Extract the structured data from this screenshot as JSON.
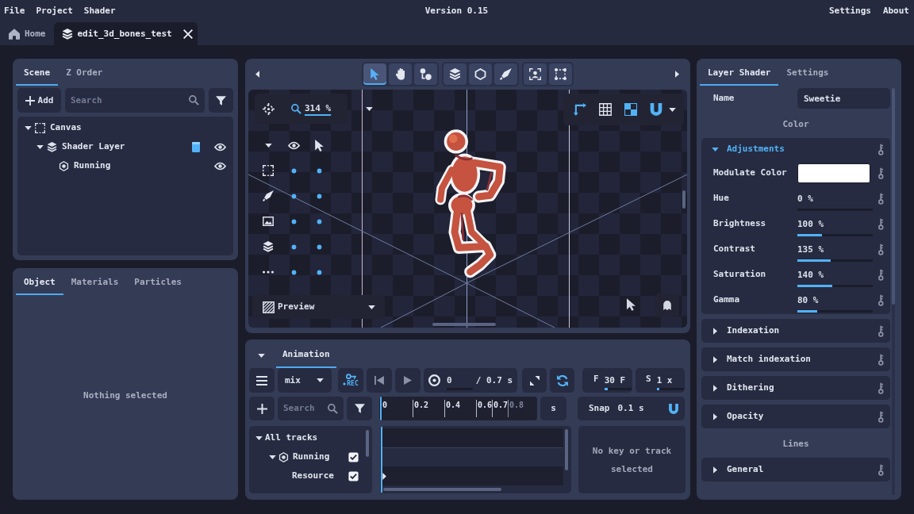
{
  "menu": {
    "items": [
      "File",
      "Project",
      "Shader"
    ],
    "version": "Version 0.15",
    "right_items": [
      "Settings",
      "About"
    ]
  },
  "tabs": [
    {
      "label": "Home",
      "kind": "home",
      "selected": false,
      "closable": false
    },
    {
      "label": "edit_3d_bones_test",
      "kind": "project",
      "selected": true,
      "closable": true
    }
  ],
  "scene_panel": {
    "tabs": [
      {
        "label": "Scene",
        "selected": true
      },
      {
        "label": "Z Order",
        "selected": false
      }
    ],
    "add_button": "Add",
    "search": {
      "placeholder": "Search"
    },
    "tree": [
      {
        "label": "Canvas",
        "kind": "canvas",
        "expanded": true,
        "children": [
          {
            "label": "Shader Layer",
            "kind": "layer",
            "expanded": true,
            "script": true,
            "visible": true,
            "children": [
              {
                "label": "Running",
                "kind": "object",
                "visible": true
              }
            ]
          }
        ]
      }
    ]
  },
  "object_panel": {
    "tabs": [
      {
        "label": "Object",
        "selected": true
      },
      {
        "label": "Materials",
        "selected": false
      },
      {
        "label": "Particles",
        "selected": false
      }
    ],
    "message": "Nothing selected"
  },
  "viewport": {
    "tool_groups": [
      {
        "tools": [
          {
            "kind": "select",
            "selected": true
          },
          {
            "kind": "pan",
            "selected": false
          },
          {
            "kind": "bones",
            "selected": false
          }
        ]
      },
      {
        "tools": [
          {
            "kind": "layers",
            "selected": false
          },
          {
            "kind": "shape",
            "selected": false
          },
          {
            "kind": "feather",
            "selected": false
          }
        ]
      },
      {
        "tools": [
          {
            "kind": "camera",
            "selected": false
          },
          {
            "kind": "polygon",
            "selected": false
          }
        ]
      }
    ],
    "zoom": "314 %",
    "layer_rows": [
      {
        "kind": "canvas",
        "visible": true,
        "selectable": true
      },
      {
        "kind": "feather",
        "visible": true,
        "selectable": true
      },
      {
        "kind": "image",
        "visible": true,
        "selectable": true
      },
      {
        "kind": "layers",
        "visible": true,
        "selectable": true
      },
      {
        "kind": "more",
        "visible": true,
        "selectable": true
      }
    ],
    "preview": "Preview",
    "view_toggles": [
      {
        "kind": "axes",
        "on": true
      },
      {
        "kind": "grid",
        "on": false
      },
      {
        "kind": "checker",
        "on": true
      },
      {
        "kind": "snap",
        "on": true
      }
    ]
  },
  "animation": {
    "expanded": true,
    "tabs": [
      {
        "label": "Animation",
        "selected": true
      }
    ],
    "blend": "mix",
    "record": "REC",
    "time": {
      "current": "0",
      "level": 0,
      "total": "/ 0.7 s"
    },
    "loop": {
      "on": true
    },
    "fps": {
      "prefix": "F",
      "value": "30 F",
      "level": 0.12
    },
    "speed": {
      "prefix": "S",
      "value": "1 x",
      "level": 0.1
    },
    "search": {
      "placeholder": "Search"
    },
    "ruler": [
      {
        "label": "0",
        "kind": "step"
      },
      {
        "label": "0.2",
        "kind": "step"
      },
      {
        "label": "0.4",
        "kind": "step"
      },
      {
        "label": "0.6",
        "kind": "step"
      },
      {
        "label": "0.7",
        "kind": "end"
      },
      {
        "label": "0.8",
        "kind": "after"
      }
    ],
    "unit": "s",
    "snap": {
      "label": "Snap",
      "value": "0.1 s",
      "on": true
    },
    "tracks": [
      {
        "label": "All tracks",
        "kind": "group",
        "expanded": true,
        "children": [
          {
            "label": "Running",
            "kind": "object",
            "expanded": true,
            "checked": true,
            "children": [
              {
                "label": "Resource",
                "kind": "property",
                "checked": true,
                "has_key": true
              }
            ]
          }
        ]
      }
    ],
    "info": "No key or track selected"
  },
  "inspector": {
    "tabs": [
      {
        "label": "Layer Shader",
        "selected": true
      },
      {
        "label": "Settings",
        "selected": false
      }
    ],
    "name": {
      "label": "Name",
      "value": "Sweetie"
    },
    "sections": [
      {
        "kind": "header",
        "label": "Color"
      },
      {
        "kind": "group",
        "label": "Adjustments",
        "expanded": true,
        "params": [
          {
            "kind": "color",
            "label": "Modulate Color",
            "color": "#ffffff"
          },
          {
            "kind": "slider",
            "label": "Hue",
            "value": "0 %",
            "level": 0
          },
          {
            "kind": "slider",
            "label": "Brightness",
            "value": "100 %",
            "level": 0.33
          },
          {
            "kind": "slider",
            "label": "Contrast",
            "value": "135 %",
            "level": 0.44
          },
          {
            "kind": "slider",
            "label": "Saturation",
            "value": "140 %",
            "level": 0.46
          },
          {
            "kind": "slider",
            "label": "Gamma",
            "value": "80 %",
            "level": 0.26
          }
        ]
      },
      {
        "kind": "group",
        "label": "Indexation",
        "expanded": false
      },
      {
        "kind": "group",
        "label": "Match indexation",
        "expanded": false
      },
      {
        "kind": "group",
        "label": "Dithering",
        "expanded": false
      },
      {
        "kind": "group",
        "label": "Opacity",
        "expanded": false
      },
      {
        "kind": "header",
        "label": "Lines"
      },
      {
        "kind": "group",
        "label": "General",
        "expanded": false
      }
    ]
  }
}
